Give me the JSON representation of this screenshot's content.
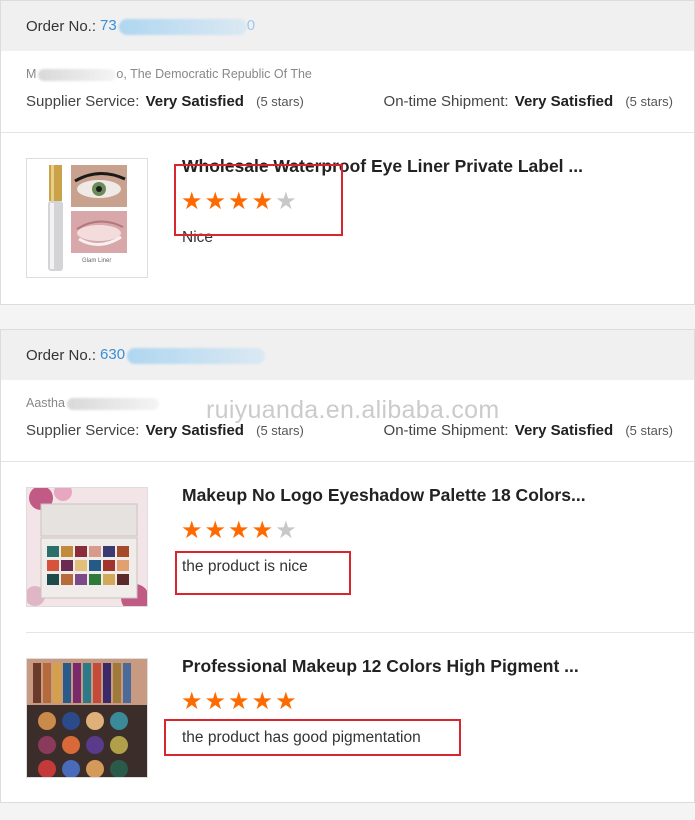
{
  "orders": [
    {
      "order_label": "Order No.:",
      "order_no_partial": "73",
      "order_no_tail": "0",
      "buyer_partial_a": "M",
      "buyer_location": "o, The Democratic Republic Of The",
      "supplier_service_label": "Supplier Service:",
      "supplier_service_value": "Very Satisfied",
      "supplier_service_stars": "(5 stars)",
      "shipment_label": "On-time Shipment:",
      "shipment_value": "Very Satisfied",
      "shipment_stars": "(5 stars)",
      "products": [
        {
          "title": "Wholesale Waterproof Eye Liner Private Label ...",
          "rating": 4,
          "comment": "Nice"
        }
      ]
    },
    {
      "order_label": "Order No.:",
      "order_no_partial": "630",
      "buyer_partial_a": "Aastha",
      "supplier_service_label": "Supplier Service:",
      "supplier_service_value": "Very Satisfied",
      "supplier_service_stars": "(5 stars)",
      "shipment_label": "On-time Shipment:",
      "shipment_value": "Very Satisfied",
      "shipment_stars": "(5 stars)",
      "products": [
        {
          "title": "Makeup No Logo Eyeshadow Palette 18 Colors...",
          "rating": 4,
          "comment": "the product is nice"
        },
        {
          "title": "Professional Makeup 12 Colors High Pigment ...",
          "rating": 5,
          "comment": "the product has good pigmentation"
        }
      ]
    }
  ],
  "watermark": "ruiyuanda.en.alibaba.com",
  "colors": {
    "accent_star": "#ff6a00",
    "star_off": "#c8c8c8",
    "link": "#3a8fd6",
    "highlight_box": "#d9262e"
  }
}
